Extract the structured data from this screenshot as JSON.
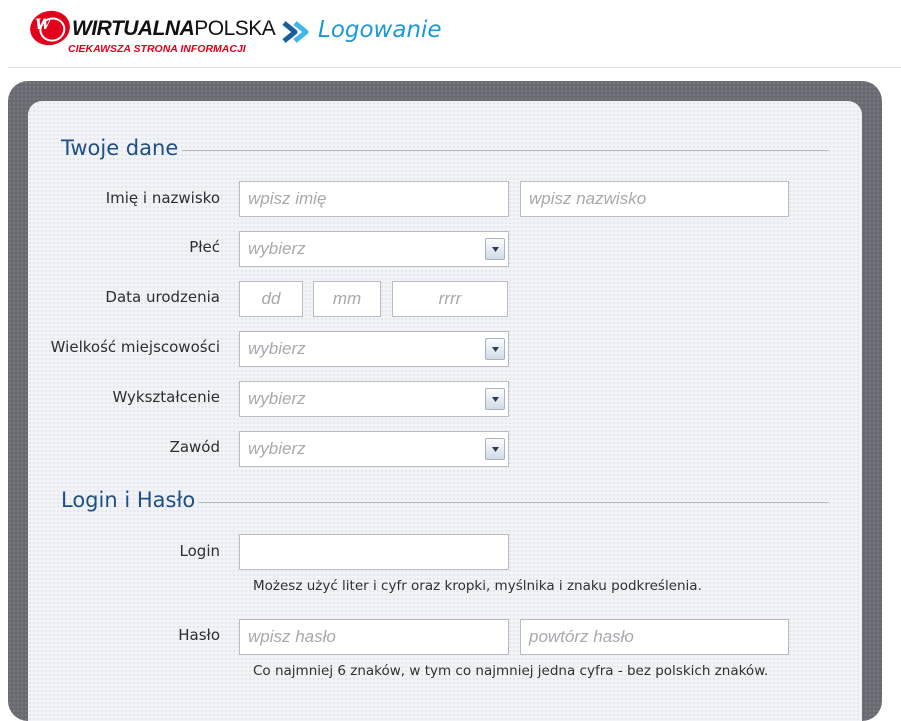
{
  "header": {
    "logo_name_bold": "WIRTUALNA",
    "logo_name_light": "POLSKA",
    "logo_tagline": "CIEKAWSZA STRONA INFORMACJI",
    "page_heading": "Logowanie"
  },
  "sections": {
    "personal": {
      "title": "Twoje dane",
      "name_label": "Imię i nazwisko",
      "first_name_placeholder": "wpisz imię",
      "last_name_placeholder": "wpisz nazwisko",
      "gender_label": "Płeć",
      "gender_value": "wybierz",
      "birthdate_label": "Data urodzenia",
      "day_placeholder": "dd",
      "month_placeholder": "mm",
      "year_placeholder": "rrrr",
      "city_size_label": "Wielkość miejscowości",
      "city_size_value": "wybierz",
      "education_label": "Wykształcenie",
      "education_value": "wybierz",
      "occupation_label": "Zawód",
      "occupation_value": "wybierz"
    },
    "credentials": {
      "title": "Login i Hasło",
      "login_label": "Login",
      "login_value": "",
      "login_hint": "Możesz użyć liter i cyfr oraz kropki, myślnika i znaku podkreślenia.",
      "password_label": "Hasło",
      "password_placeholder": "wpisz hasło",
      "password_repeat_placeholder": "powtórz hasło",
      "password_hint": "Co najmniej 6 znaków, w tym co najmniej jedna cyfra - bez polskich znaków."
    }
  },
  "colors": {
    "brand_red": "#e3001b",
    "heading_blue": "#1d9ad6",
    "section_title_blue": "#1f4f85",
    "frame_gray": "#676a71",
    "panel_bg": "#f1f3f6"
  }
}
